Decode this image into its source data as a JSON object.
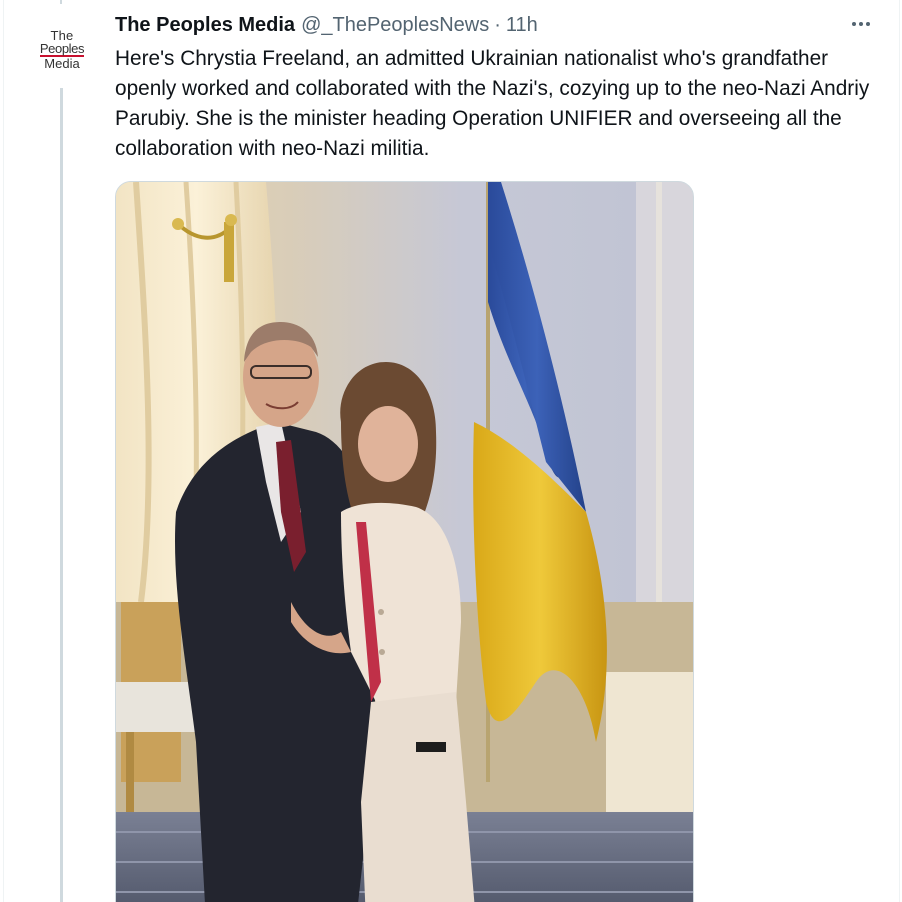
{
  "tweet": {
    "author": {
      "display_name": "The Peoples Media",
      "handle": "@_ThePeoplesNews",
      "avatar_text": [
        "The",
        "Peoples",
        "Media"
      ]
    },
    "separator": "·",
    "time": "11h",
    "text": "Here's Chrystia Freeland, an admitted Ukrainian nationalist who's grandfather openly worked and collaborated with the Nazi's, cozying up to the neo-Nazi Andriy Parubiy. She is the minister heading Operation UNIFIER and overseeing all the collaboration with neo-Nazi militia.",
    "more_icon": "more-horizontal-icon"
  },
  "colors": {
    "text_primary": "#0f1419",
    "text_secondary": "#536471",
    "thread_line": "#cfd9de",
    "avatar_underline": "#c8102e",
    "flag_blue": "#2b50a8",
    "flag_yellow": "#e8c020"
  }
}
